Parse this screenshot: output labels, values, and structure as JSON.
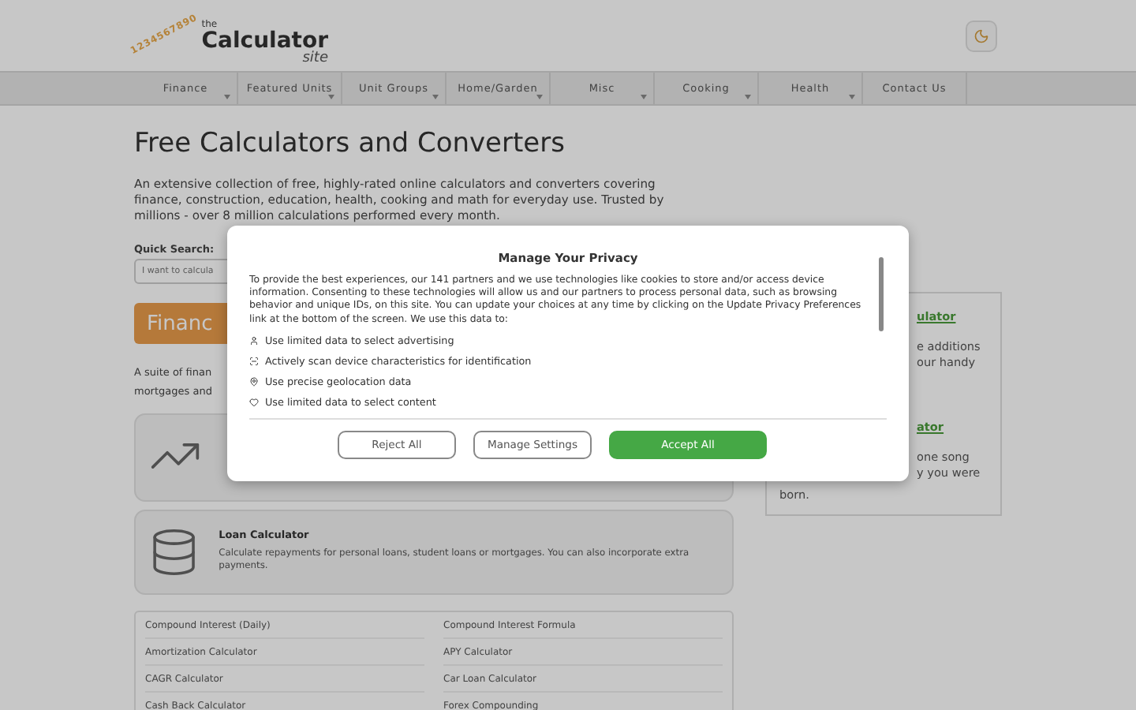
{
  "logo": {
    "digits": "1234567890",
    "small": "the",
    "name": "Calculator",
    "sub": "site"
  },
  "nav": [
    {
      "label": "Finance",
      "dropdown": true
    },
    {
      "label": "Featured Units",
      "dropdown": true
    },
    {
      "label": "Unit Groups",
      "dropdown": true
    },
    {
      "label": "Home/Garden",
      "dropdown": true
    },
    {
      "label": "Misc",
      "dropdown": true
    },
    {
      "label": "Cooking",
      "dropdown": true
    },
    {
      "label": "Health",
      "dropdown": true
    },
    {
      "label": "Contact Us",
      "dropdown": false
    }
  ],
  "page": {
    "title": "Free Calculators and Converters",
    "intro": "An extensive collection of free, highly-rated online calculators and converters covering finance, construction, education, health, cooking and math for everyday use. Trusted by millions - over 8 million calculations performed every month.",
    "search_label": "Quick Search:",
    "search_placeholder": "I want to calcula",
    "section_title": "Financ",
    "section_lines": [
      "A suite of finan",
      "mortgages and"
    ]
  },
  "cards": [
    {
      "kind": "partial"
    },
    {
      "title": "Loan Calculator",
      "lines": [
        "Calculate repayments for personal loans, student loans or mortgages. You can also incorporate extra payments."
      ]
    }
  ],
  "links": [
    "Compound Interest (Daily)",
    "Compound Interest Formula",
    "Amortization Calculator",
    "APY Calculator",
    "CAGR Calculator",
    "Car Loan Calculator",
    "Cash Back Calculator",
    "Forex Compounding"
  ],
  "side_card": [
    {
      "kind": "link",
      "text": "ulator"
    },
    {
      "kind": "text",
      "text": "e additions"
    },
    {
      "kind": "text",
      "text": "our handy"
    },
    {
      "kind": "link",
      "text": "ator"
    },
    {
      "kind": "text",
      "text": "one song"
    },
    {
      "kind": "text",
      "text": "y you were"
    },
    {
      "kind": "text",
      "text": "born."
    }
  ],
  "dialog": {
    "title": "Manage Your Privacy",
    "body": "To provide the best experiences, our 141 partners and we use technologies like cookies to store and/or access device information. Consenting to these technologies will allow us and our partners to process personal data, such as browsing behavior and unique IDs, on this site. You can update your choices at any time by clicking on the Update Privacy Preferences link at the bottom of the screen. We use this data to:",
    "purposes": [
      "Use limited data to select advertising",
      "Actively scan device characteristics for identification",
      "Use precise geolocation data",
      "Use limited data to select content"
    ],
    "buttons": [
      {
        "label": "Reject All",
        "kind": "outline"
      },
      {
        "label": "Manage Settings",
        "kind": "outline"
      },
      {
        "label": "Accept All",
        "kind": "primary"
      }
    ]
  }
}
